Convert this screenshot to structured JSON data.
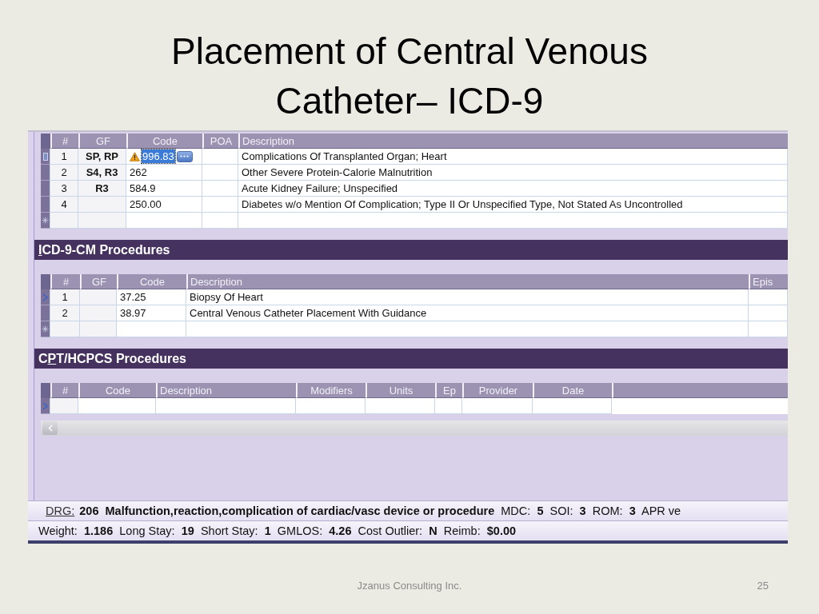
{
  "slide": {
    "title": "Placement of Central Venous Catheter– ICD-9",
    "footer": "Jzanus Consulting Inc.",
    "page_number": "25"
  },
  "diagnoses": {
    "columns": [
      "#",
      "GF",
      "Code",
      "POA",
      "Description"
    ],
    "rows": [
      {
        "kind": "edit",
        "number": "1",
        "gf": "SP, RP",
        "code": "996.83",
        "description": "Complications Of Transplanted Organ; Heart",
        "warning": true,
        "editing": true
      },
      {
        "kind": "none",
        "number": "2",
        "gf": "S4, R3",
        "code": "262",
        "description": "Other Severe Protein-Calorie Malnutrition",
        "warning": false,
        "editing": false
      },
      {
        "kind": "none",
        "number": "3",
        "gf": "R3",
        "code": "584.9",
        "description": "Acute Kidney Failure; Unspecified",
        "warning": false,
        "editing": false
      },
      {
        "kind": "none",
        "number": "4",
        "code": "250.00",
        "description": "Diabetes w/o Mention Of Complication; Type II Or Unspecified Type, Not Stated As Uncontrolled",
        "warning": false,
        "editing": false
      },
      {
        "kind": "new",
        "warning": false,
        "editing": false
      }
    ]
  },
  "icd_procedures": {
    "title": [
      {
        "text": "I",
        "underlined": true
      },
      {
        "text": "CD-9-CM Procedures",
        "underlined": false
      }
    ],
    "columns": [
      "#",
      "GF",
      "Code",
      "Description",
      "Epis"
    ],
    "rows": [
      {
        "kind": "current",
        "number": "1",
        "code": "37.25",
        "description": "Biopsy Of Heart"
      },
      {
        "kind": "none",
        "number": "2",
        "code": "38.97",
        "description": "Central Venous Catheter Placement With Guidance"
      },
      {
        "kind": "new"
      }
    ]
  },
  "cpt_procedures": {
    "title": [
      {
        "text": "C",
        "underlined": false
      },
      {
        "text": "P",
        "underlined": true
      },
      {
        "text": "T/HCPCS Procedures",
        "underlined": false
      }
    ],
    "columns": [
      "#",
      "Code",
      "Description",
      "Modifiers",
      "Units",
      "Ep",
      "Provider",
      "Date"
    ],
    "rows": [
      {
        "kind": "current"
      }
    ]
  },
  "drg_bar": {
    "link": "DRG:",
    "text": "**206**  **Malfunction,reaction,complication of cardiac/vasc device or procedure**  MDC:  **5**  SOI:  **3**  ROM:  **3**  APR ve"
  },
  "stats_bar": {
    "text": "Weight:  **1.186**  Long Stay:  **19**  Short Stay:  **1**  GMLOS:  **4.26**  Cost Outlier:  **N**  Reimb:  **$0.00**"
  }
}
